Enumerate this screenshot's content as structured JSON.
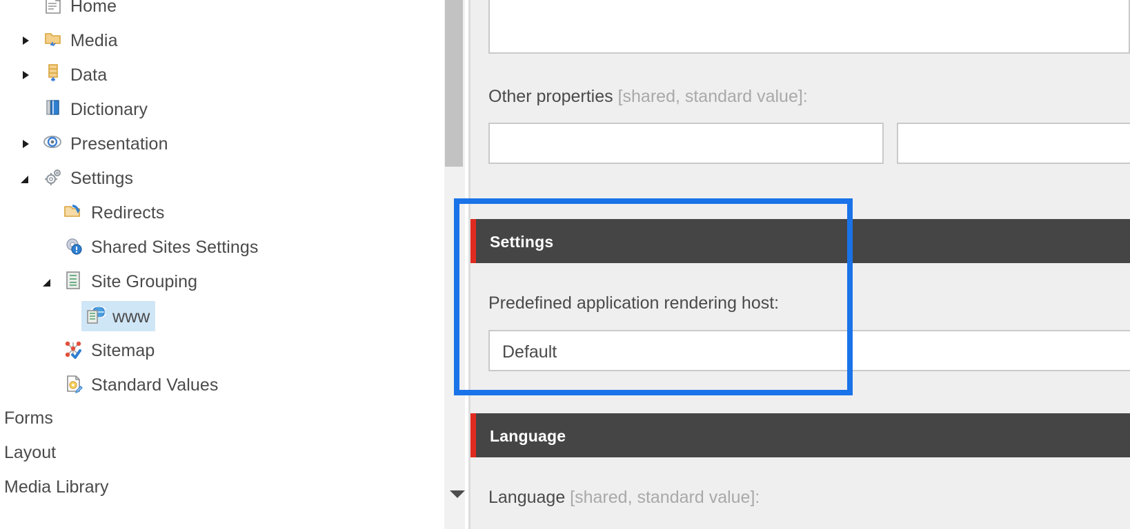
{
  "app": {
    "accent_highlight": "#1a73e8",
    "section_header_bg": "#454545",
    "section_accent_bar": "#e02b20",
    "content_bg": "#efefef",
    "selected_row_bg": "#cfe6f7"
  },
  "tree": {
    "items": [
      {
        "label": "Home",
        "icon": "document-icon",
        "indent": 0,
        "toggle": "none",
        "selected": false
      },
      {
        "label": "Media",
        "icon": "folder-media-icon",
        "indent": 0,
        "toggle": "collapsed",
        "selected": false
      },
      {
        "label": "Data",
        "icon": "database-icon",
        "indent": 0,
        "toggle": "collapsed",
        "selected": false
      },
      {
        "label": "Dictionary",
        "icon": "book-icon",
        "indent": 0,
        "toggle": "none",
        "selected": false
      },
      {
        "label": "Presentation",
        "icon": "eye-icon",
        "indent": 0,
        "toggle": "collapsed",
        "selected": false
      },
      {
        "label": "Settings",
        "icon": "gears-icon",
        "indent": 0,
        "toggle": "expanded",
        "selected": false
      },
      {
        "label": "Redirects",
        "icon": "redirect-arrow-icon",
        "indent": 1,
        "toggle": "none",
        "selected": false
      },
      {
        "label": "Shared Sites Settings",
        "icon": "gear-info-icon",
        "indent": 1,
        "toggle": "none",
        "selected": false
      },
      {
        "label": "Site Grouping",
        "icon": "server-list-icon",
        "indent": 1,
        "toggle": "expanded",
        "selected": false
      },
      {
        "label": "www",
        "icon": "globe-server-icon",
        "indent": 2,
        "toggle": "none",
        "selected": true
      },
      {
        "label": "Sitemap",
        "icon": "sitemap-icon",
        "indent": 1,
        "toggle": "none",
        "selected": false
      },
      {
        "label": "Standard Values",
        "icon": "standard-values-icon",
        "indent": 1,
        "toggle": "none",
        "selected": false
      }
    ],
    "links": [
      {
        "label": "Forms"
      },
      {
        "label": "Layout"
      },
      {
        "label": "Media Library"
      }
    ]
  },
  "content": {
    "top_field": {
      "value": "",
      "placeholder": ""
    },
    "other_properties": {
      "label": "Other properties",
      "qualifier": " [shared, standard value]:",
      "field_left": {
        "value": "",
        "placeholder": ""
      },
      "field_right": {
        "value": "",
        "placeholder": ""
      }
    },
    "settings_section": {
      "title": "Settings",
      "rendering_host_label": "Predefined application rendering host:",
      "rendering_host_value": "Default"
    },
    "language_section": {
      "title": "Language",
      "label": "Language",
      "qualifier": " [shared, standard value]:"
    }
  },
  "scrollbar": {
    "thumb_position": "top",
    "down_arrow": "chevron-down-icon"
  }
}
